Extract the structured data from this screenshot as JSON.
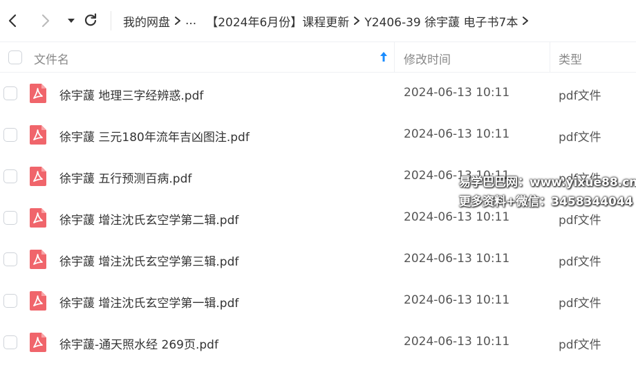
{
  "toolbar": {
    "back_icon": "chevron-left-icon",
    "forward_icon": "chevron-right-icon",
    "menu_icon": "caret-down-icon",
    "refresh_icon": "refresh-icon"
  },
  "breadcrumb": {
    "items": [
      "我的网盘",
      "...",
      "【2024年6月份】课程更新",
      "Y2406-39 徐宇蘐 电子书7本"
    ]
  },
  "header": {
    "name": "文件名",
    "mtime": "修改时间",
    "type": "类型"
  },
  "files": [
    {
      "name": "徐宇蘐 地理三字经辨惑.pdf",
      "mtime": "2024-06-13 10:11",
      "type": "pdf文件"
    },
    {
      "name": "徐宇蘐 三元180年流年吉凶图注.pdf",
      "mtime": "2024-06-13 10:11",
      "type": "pdf文件"
    },
    {
      "name": "徐宇蘐 五行预测百病.pdf",
      "mtime": "2024-06-13 10:11",
      "type": "pdf文件"
    },
    {
      "name": "徐宇蘐 增注沈氏玄空学第二辑.pdf",
      "mtime": "2024-06-13 10:11",
      "type": "pdf文件"
    },
    {
      "name": "徐宇蘐 增注沈氏玄空学第三辑.pdf",
      "mtime": "2024-06-13 10:11",
      "type": "pdf文件"
    },
    {
      "name": "徐宇蘐 增注沈氏玄空学第一辑.pdf",
      "mtime": "2024-06-13 10:11",
      "type": "pdf文件"
    },
    {
      "name": "徐宇蘐-通天照水经 269页.pdf",
      "mtime": "2024-06-13 10:11",
      "type": "pdf文件"
    }
  ],
  "watermark": {
    "line1": "易学巴巴网：www.yixue88.cn",
    "line2": "更多资料+微信：3458344044"
  },
  "colors": {
    "pdf_icon": "#f0656b",
    "sort_arrow": "#1a8cff",
    "border": "#eef0f3"
  }
}
